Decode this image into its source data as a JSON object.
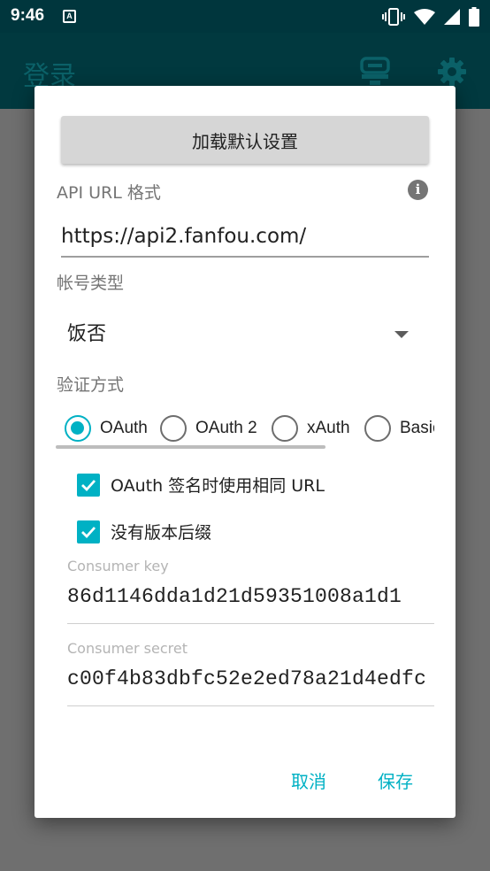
{
  "status_bar": {
    "time": "9:46",
    "notification_icon": "A",
    "icons": [
      "vibrate-icon",
      "wifi-icon",
      "signal-icon",
      "battery-icon"
    ]
  },
  "app_bar": {
    "title": "登录",
    "icons": [
      "server-icon",
      "gear-icon"
    ]
  },
  "dialog": {
    "load_defaults_label": "加载默认设置",
    "api_url_label": "API URL 格式",
    "api_url_value": "https://api2.fanfou.com/",
    "account_type_label": "帐号类型",
    "account_type_value": "饭否",
    "auth_method_label": "验证方式",
    "auth_options": [
      {
        "label": "OAuth",
        "checked": true
      },
      {
        "label": "OAuth 2",
        "checked": false
      },
      {
        "label": "xAuth",
        "checked": false
      },
      {
        "label": "Basic",
        "checked": false
      }
    ],
    "same_url_label": "OAuth 签名时使用相同 URL",
    "same_url_checked": true,
    "no_version_suffix_label": "没有版本后缀",
    "no_version_suffix_checked": true,
    "consumer_key_hint": "Consumer key",
    "consumer_key_value": "86d1146dda1d21d59351008a1d1",
    "consumer_secret_hint": "Consumer secret",
    "consumer_secret_value": "c00f4b83dbfc52e2ed78a21d4edfc",
    "cancel_label": "取消",
    "save_label": "保存"
  },
  "colors": {
    "accent": "#00b1c4",
    "status_bar": "#00363d",
    "scrim": "#6f6f6f"
  }
}
